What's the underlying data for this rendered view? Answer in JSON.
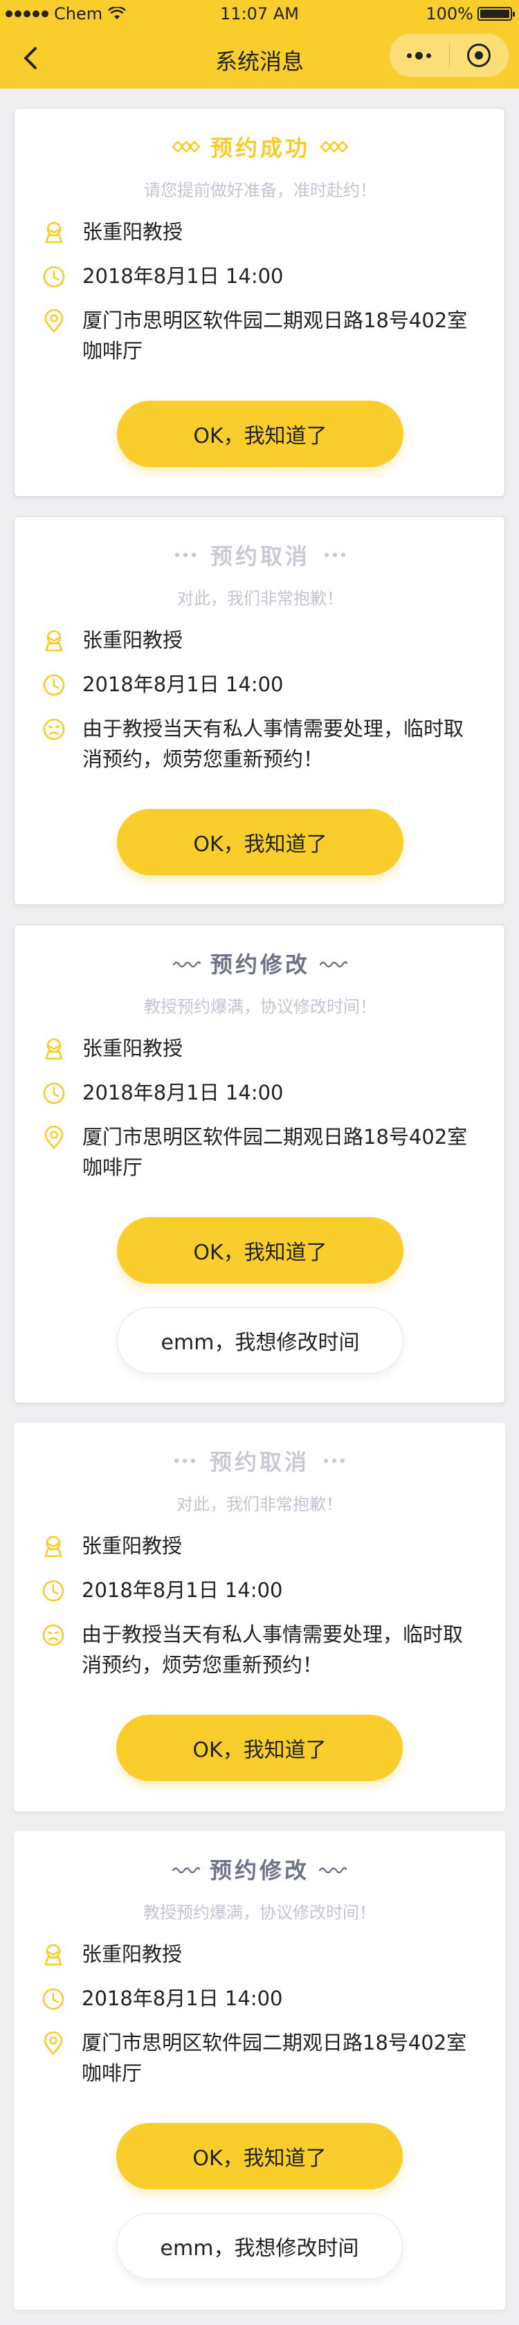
{
  "status_bar": {
    "carrier": "Chem",
    "time": "11:07 AM",
    "battery": "100%"
  },
  "nav": {
    "title": "系统消息",
    "back_icon": "chevron-left-icon",
    "more_icon": "more-dots-icon",
    "close_icon": "target-circle-icon"
  },
  "colors": {
    "brand_yellow": "#f9cd2b",
    "title_gray": "#c9cad5",
    "title_dark": "#6e7487",
    "subtitle": "#c2c4d4",
    "background": "#efeff2"
  },
  "cards": [
    {
      "title": "预约成功",
      "subtitle": "请您提前做好准备，准时赴约！",
      "professor": "张重阳教授",
      "time": "2018年8月1日 14:00",
      "detail": "厦门市思明区软件园二期观日路18号402室咖啡厅",
      "detail_icon": "location-pin-icon",
      "primary_button": "OK，我知道了"
    },
    {
      "title": "预约取消",
      "subtitle": "对此，我们非常抱歉！",
      "professor": "张重阳教授",
      "time": "2018年8月1日 14:00",
      "detail": "由于教授当天有私人事情需要处理，临时取消预约，烦劳您重新预约！",
      "detail_icon": "sad-face-icon",
      "primary_button": "OK，我知道了"
    },
    {
      "title": "预约修改",
      "subtitle": "教授预约爆满，协议修改时间！",
      "professor": "张重阳教授",
      "time": "2018年8月1日 14:00",
      "detail": "厦门市思明区软件园二期观日路18号402室咖啡厅",
      "detail_icon": "location-pin-icon",
      "primary_button": "OK，我知道了",
      "secondary_button": "emm，我想修改时间"
    },
    {
      "title": "预约取消",
      "subtitle": "对此，我们非常抱歉！",
      "professor": "张重阳教授",
      "time": "2018年8月1日 14:00",
      "detail": "由于教授当天有私人事情需要处理，临时取消预约，烦劳您重新预约！",
      "detail_icon": "sad-face-icon",
      "primary_button": "OK，我知道了"
    },
    {
      "title": "预约修改",
      "subtitle": "教授预约爆满，协议修改时间！",
      "professor": "张重阳教授",
      "time": "2018年8月1日 14:00",
      "detail": "厦门市思明区软件园二期观日路18号402室咖啡厅",
      "detail_icon": "location-pin-icon",
      "primary_button": "OK，我知道了",
      "secondary_button": "emm，我想修改时间"
    }
  ]
}
